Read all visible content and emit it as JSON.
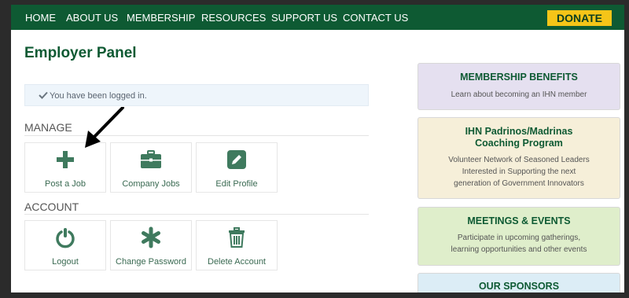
{
  "nav": {
    "items": [
      "HOME",
      "ABOUT US",
      "MEMBERSHIP",
      "RESOURCES",
      "SUPPORT US",
      "CONTACT US"
    ],
    "donate": "DONATE"
  },
  "panel": {
    "title": "Employer Panel",
    "alert": "You have been logged in.",
    "manage_label": "MANAGE",
    "account_label": "ACCOUNT",
    "manage_tiles": [
      {
        "label": "Post a Job",
        "icon": "plus-icon"
      },
      {
        "label": "Company Jobs",
        "icon": "briefcase-icon"
      },
      {
        "label": "Edit Profile",
        "icon": "pencil-square-icon"
      }
    ],
    "account_tiles": [
      {
        "label": "Logout",
        "icon": "power-icon"
      },
      {
        "label": "Change Password",
        "icon": "asterisk-icon"
      },
      {
        "label": "Delete Account",
        "icon": "trash-icon"
      }
    ]
  },
  "sidebar": {
    "cards": [
      {
        "title": "MEMBERSHIP BENEFITS",
        "text": [
          "Learn about becoming an IHN member"
        ],
        "bg": "#e5e0f0"
      },
      {
        "title": "IHN Padrinos/Madrinas Coaching Program",
        "title_lines": [
          "IHN Padrinos/Madrinas",
          "Coaching Program"
        ],
        "text": [
          "Volunteer Network of Seasoned Leaders",
          "Interested in Supporting the next",
          "generation of Government Innovators"
        ],
        "bg": "#f6efd9"
      },
      {
        "title": "MEETINGS & EVENTS",
        "text": [
          "Participate in upcoming gatherings,",
          "learning opportunities and other events"
        ],
        "bg": "#dfeecb"
      },
      {
        "title": "OUR SPONSORS",
        "text": [],
        "bg": "#dcedf6"
      }
    ]
  },
  "colors": {
    "nav_green": "#0e5a33",
    "donate_yellow": "#f5c518",
    "icon_green": "#3f7a5e"
  }
}
